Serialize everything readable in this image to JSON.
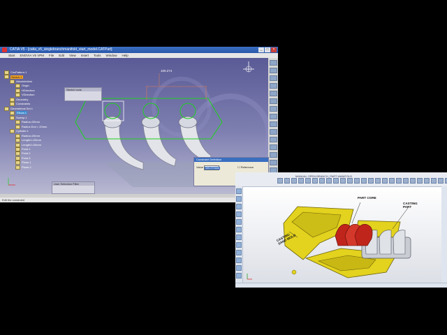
{
  "catia": {
    "title": "CATIA V5 - [catia_v5_singlebranchmanifold_start_model.CATPart]",
    "menu": [
      "Start",
      "ENOVIA V5 VPM",
      "File",
      "Edit",
      "View",
      "Insert",
      "Tools",
      "Window",
      "Help"
    ],
    "status": "Edit the constraint",
    "tree": [
      {
        "label": "CircPattern.1",
        "state": ""
      },
      {
        "label": "Sketch.1",
        "state": "sel"
      },
      {
        "label": "AbsoluteAxis",
        "state": ""
      },
      {
        "label": "Origin",
        "state": ""
      },
      {
        "label": "HDirection",
        "state": ""
      },
      {
        "label": "VDirection",
        "state": ""
      },
      {
        "label": "Geometry",
        "state": ""
      },
      {
        "label": "Constraints",
        "state": ""
      },
      {
        "label": "Geometrical Set.1",
        "state": ""
      },
      {
        "label": "Elbow.1",
        "state": "hl"
      },
      {
        "label": "Sweep.1",
        "state": ""
      },
      {
        "label": "Radius=20mm",
        "state": ""
      },
      {
        "label": "Radius End = 20mm",
        "state": ""
      },
      {
        "label": "Cylinder.1",
        "state": ""
      },
      {
        "label": "Radius=20mm",
        "state": ""
      },
      {
        "label": "Length1=20mm",
        "state": ""
      },
      {
        "label": "Length2=20mm",
        "state": ""
      },
      {
        "label": "Point.1",
        "state": ""
      },
      {
        "label": "Point.2",
        "state": ""
      },
      {
        "label": "Point.3",
        "state": ""
      },
      {
        "label": "Plane.1",
        "state": ""
      },
      {
        "label": "Plane.2",
        "state": ""
      }
    ],
    "dimension_text": "100.274",
    "sketch_tools_title": "Sketch tools",
    "selection_filter_title": "User Selection Filter",
    "dialog": {
      "title": "Constraint Definition",
      "value_label": "Value",
      "value": "100.274mm",
      "reference_label": "Reference"
    }
  },
  "cast": {
    "toolbar_label": "MANUAL OPEN  BRANCH_PART  MANIFOLD",
    "labels": {
      "part_core": "PART CORE",
      "casting_part": "CASTING\nPART",
      "casting_sand_mold": "CASTING\nSAND MOLD"
    },
    "colors": {
      "mold": "#e3d21e",
      "core": "#c0251b",
      "part": "#c9ccd2",
      "viewport": "#3e3eb0"
    }
  }
}
